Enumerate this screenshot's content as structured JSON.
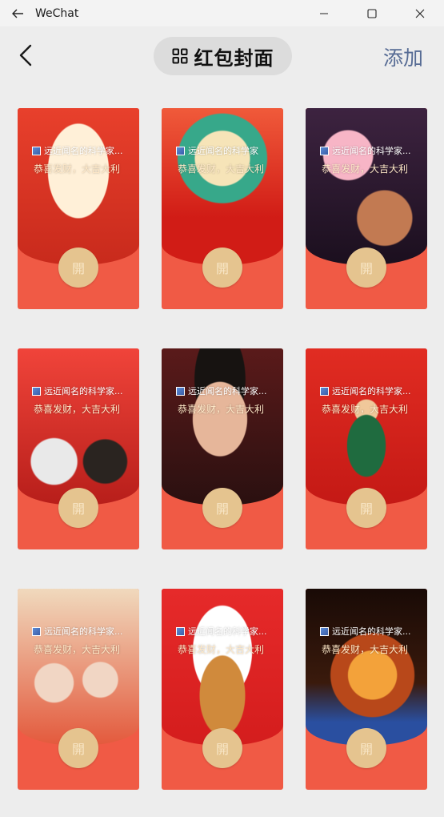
{
  "window": {
    "title": "WeChat"
  },
  "header": {
    "title": "红包封面",
    "add_label": "添加"
  },
  "covers": [
    {
      "sender": "远近闻名的科学家...",
      "greeting": "恭喜发财，大吉大利",
      "open_label": "開"
    },
    {
      "sender": "远近闻名的科学家",
      "greeting": "恭喜发财，大吉大利",
      "open_label": "開"
    },
    {
      "sender": "远近闻名的科学家...",
      "greeting": "恭喜发财，大吉大利",
      "open_label": "開"
    },
    {
      "sender": "远近闻名的科学家...",
      "greeting": "恭喜发财，大吉大利",
      "open_label": "開"
    },
    {
      "sender": "远近闻名的科学家...",
      "greeting": "恭喜发财，大吉大利",
      "open_label": "開"
    },
    {
      "sender": "远近闻名的科学家...",
      "greeting": "恭喜发财，大吉大利",
      "open_label": "開"
    },
    {
      "sender": "远近闻名的科学家...",
      "greeting": "恭喜发财，大吉大利",
      "open_label": "開"
    },
    {
      "sender": "远近闻名的科学家...",
      "greeting": "恭喜发财，大吉大利",
      "open_label": "開"
    },
    {
      "sender": "远近闻名的科学家...",
      "greeting": "恭喜发财，大吉大利",
      "open_label": "開"
    }
  ],
  "icons": {
    "titlebar_back": "back-arrow-icon",
    "minimize": "minimize-icon",
    "maximize": "maximize-icon",
    "close": "close-icon",
    "header_back": "chevron-left-icon",
    "title_grid": "grid-icon"
  },
  "colors": {
    "background": "#ededed",
    "card_red": "#f05a45",
    "open_button": "#e5c48f",
    "add_link": "#566b94"
  }
}
